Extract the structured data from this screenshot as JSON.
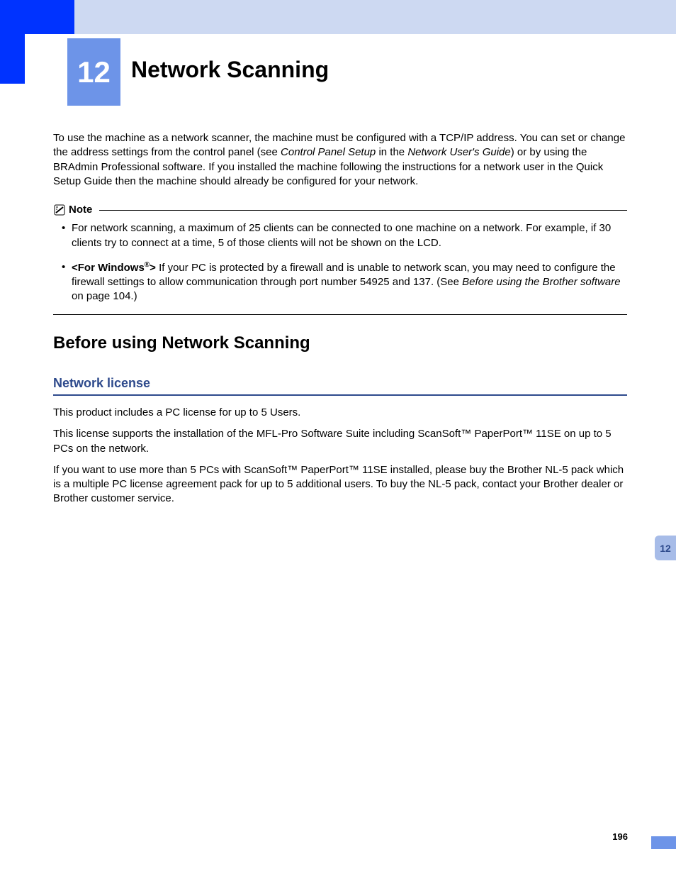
{
  "chapter": {
    "number": "12",
    "title": "Network Scanning"
  },
  "intro": {
    "text_before_cps": "To use the machine as a network scanner, the machine must be configured with a TCP/IP address. You can set or change the address settings from the control panel (see ",
    "cps": "Control Panel Setup",
    "in_the": " in the ",
    "nug": "Network User's Guide",
    "text_after": ") or by using the BRAdmin Professional software. If you installed the machine following the instructions for a network user in the Quick Setup Guide then the machine should already be configured for your network."
  },
  "note": {
    "label": "Note",
    "item1": "For network scanning, a maximum of 25 clients can be connected to one machine on a network. For example, if 30 clients try to connect at a time, 5 of those clients will not be shown on the LCD.",
    "item2_prefix": "<For Windows",
    "item2_sup": "®",
    "item2_suffix": ">",
    "item2_body": " If your PC is protected by a firewall and is unable to network scan, you may need to configure the firewall settings to allow communication through port number 54925 and 137. (See ",
    "item2_link": "Before using the Brother software",
    "item2_pageref": " on page 104.)"
  },
  "section": {
    "heading": "Before using Network Scanning"
  },
  "subsection": {
    "heading": "Network license",
    "p1": "This product includes a PC license for up to 5 Users.",
    "p2": "This license supports the installation of the MFL-Pro Software Suite including ScanSoft™ PaperPort™ 11SE on up to 5 PCs on the network.",
    "p3": "If you want to use more than 5 PCs with ScanSoft™ PaperPort™ 11SE installed, please buy the Brother NL-5 pack which is a multiple PC license agreement pack for up to 5 additional users. To buy the NL-5 pack, contact your Brother dealer or Brother customer service."
  },
  "sidetab": "12",
  "page_number": "196"
}
